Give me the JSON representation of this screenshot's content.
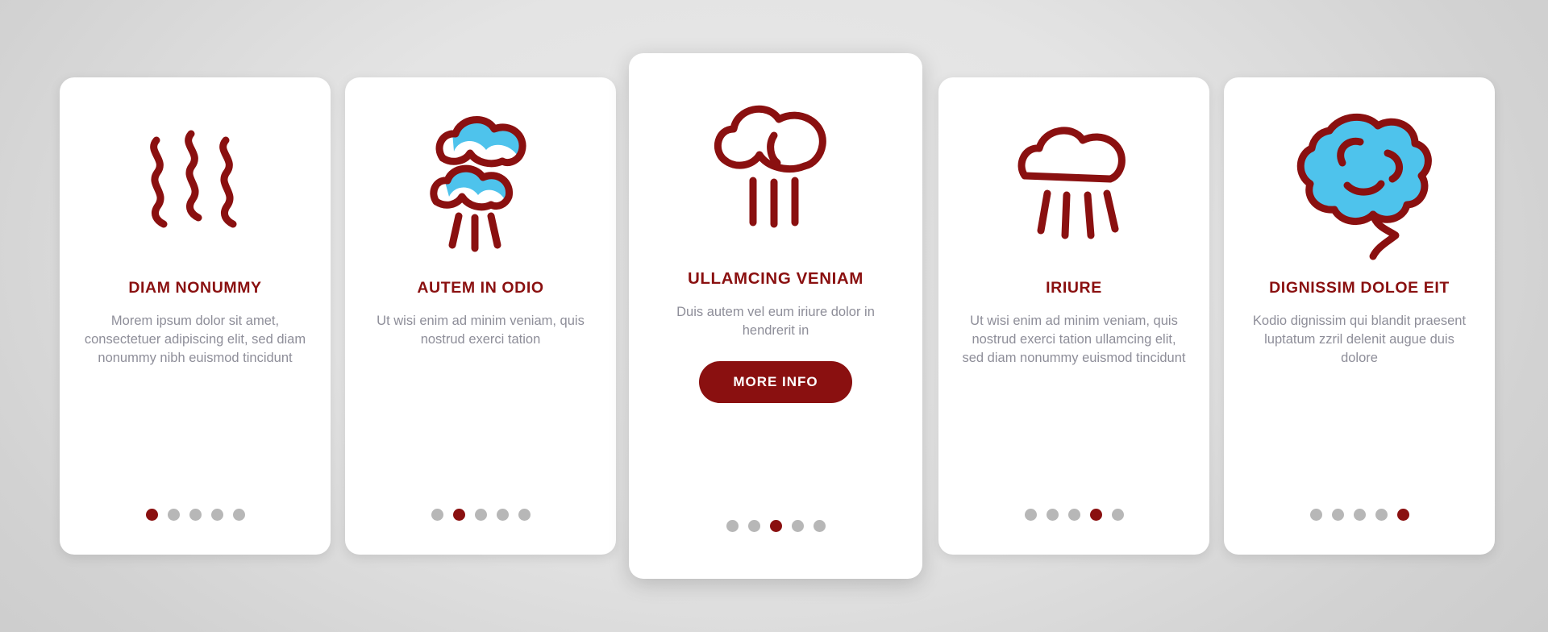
{
  "palette": {
    "accent": "#8a1010",
    "cyan": "#4ec3ec",
    "body_text": "#8e8e99",
    "dot_inactive": "#b7b7b7",
    "card_bg": "#ffffff",
    "background": "#d6d6d6"
  },
  "cards": [
    {
      "id": "card-diam-nonummy",
      "icon": "smoke-wavy-lines-icon",
      "title": "DIAM NONUMMY",
      "body": "Morem ipsum dolor sit amet, consectetuer adipiscing elit, sed diam nonummy nibh euismod tincidunt",
      "featured": false,
      "dots": {
        "count": 5,
        "active": 0
      }
    },
    {
      "id": "card-autem-in-odio",
      "icon": "double-cloud-burst-icon",
      "title": "AUTEM IN ODIO",
      "body": "Ut wisi enim ad minim veniam, quis nostrud exerci tation",
      "featured": false,
      "dots": {
        "count": 5,
        "active": 1
      }
    },
    {
      "id": "card-ullamcing-veniam",
      "icon": "cloud-rain-icon",
      "title": "ULLAMCING VENIAM",
      "body": "Duis autem vel eum iriure dolor in hendrerit in",
      "featured": true,
      "button_label": "MORE INFO",
      "dots": {
        "count": 5,
        "active": 2
      }
    },
    {
      "id": "card-iriure",
      "icon": "cloud-outline-rays-icon",
      "title": "IRIURE",
      "body": "Ut wisi enim ad minim veniam, quis nostrud exerci tation ullamcing elit, sed diam nonummy euismod tincidunt",
      "featured": false,
      "dots": {
        "count": 5,
        "active": 3
      }
    },
    {
      "id": "card-dignissim-doloe-eit",
      "icon": "cotton-candy-cloud-icon",
      "title": "DIGNISSIM DOLOE EIT",
      "body": "Kodio dignissim qui blandit praesent luptatum zzril delenit augue duis dolore",
      "featured": false,
      "dots": {
        "count": 5,
        "active": 4
      }
    }
  ]
}
